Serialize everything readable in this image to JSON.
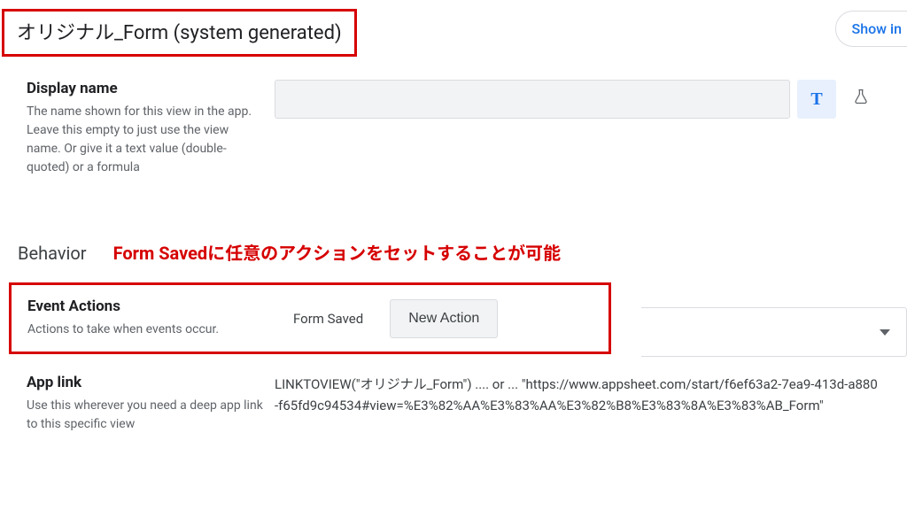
{
  "header": {
    "title": "オリジナル_Form (system generated)",
    "showInLabel": "Show in"
  },
  "displayName": {
    "title": "Display name",
    "description": "The name shown for this view in the app. Leave this empty to just use the view name. Or give it a text value (double-quoted) or a formula"
  },
  "toggles": {
    "text": "T",
    "flask": "⚗"
  },
  "behavior": {
    "sectionTitle": "Behavior",
    "annotation": "Form Savedに任意のアクションをセットすることが可能"
  },
  "eventActions": {
    "title": "Event Actions",
    "description": "Actions to take when events occur.",
    "eventName": "Form Saved",
    "buttonLabel": "New Action"
  },
  "appLink": {
    "title": "App link",
    "description": "Use this wherever you need a deep app link to this specific view",
    "value": "LINKTOVIEW(\"オリジナル_Form\") .... or ... \"https://www.appsheet.com/start/f6ef63a2-7ea9-413d-a880-f65fd9c94534#view=%E3%82%AA%E3%83%AA%E3%82%B8%E3%83%8A%E3%83%AB_Form\""
  }
}
